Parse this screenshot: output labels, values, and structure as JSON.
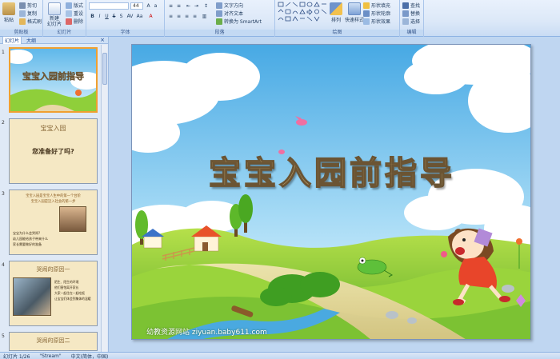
{
  "ribbon": {
    "clipboard": {
      "label": "剪贴板",
      "paste": "粘贴",
      "cut": "剪切",
      "copy": "复制",
      "format_painter": "格式刷"
    },
    "slides": {
      "label": "幻灯片",
      "new_slide": "新建\n幻灯片",
      "layout": "版式",
      "reset": "重设",
      "delete": "删除"
    },
    "font": {
      "label": "字体",
      "font_size": "44"
    },
    "paragraph": {
      "label": "段落",
      "text_direction": "文字方向",
      "align_text": "对齐文本",
      "convert_smartart": "转换为 SmartArt"
    },
    "drawing": {
      "label": "绘图",
      "arrange": "排列",
      "quick_styles": "快速样式",
      "shape_fill": "形状填充",
      "shape_outline": "形状轮廓",
      "shape_effects": "形状效果"
    },
    "editing": {
      "label": "编辑",
      "find": "查找",
      "replace": "替换",
      "select": "选择"
    }
  },
  "panel": {
    "tabs": [
      "幻灯片",
      "大纲"
    ],
    "close": "×",
    "thumbnails": [
      {
        "num": "1",
        "title": "宝宝入园前指导"
      },
      {
        "num": "2",
        "title": "宝宝入园",
        "subtitle": "您准备好了吗?"
      },
      {
        "num": "3",
        "line1": "宝宝入园是宝宝人生中的第一个台阶",
        "line2": "宝宝入园是迈入社会的第一步",
        "bullets": [
          "宝宝为什么会哭闹?",
          "幼儿园能给孩子带来什么",
          "家长需要做好的准备"
        ]
      },
      {
        "num": "4",
        "title": "哭闹的原因一",
        "bullets": [
          "陌生、陌生的环境",
          "他们害怕离开家长",
          "大家一起住在一起吃饭",
          "让宝宝们体会到集体的温暖"
        ]
      },
      {
        "num": "5",
        "title": "哭闹的原因二"
      }
    ]
  },
  "slide": {
    "title": "宝宝入园前指导",
    "watermark": "幼教资源网站 ziyuan.baby611.com"
  },
  "status": {
    "slide_count": "幻灯片 1/26",
    "theme": "\"Stream\"",
    "language": "中文(简体，中国)"
  },
  "colors": {
    "title_fill": "#b59a64",
    "title_stroke": "#6b5433",
    "sky": "#5fb8ea",
    "grass": "#8fcf3a",
    "accent_orange": "#f0a030"
  }
}
